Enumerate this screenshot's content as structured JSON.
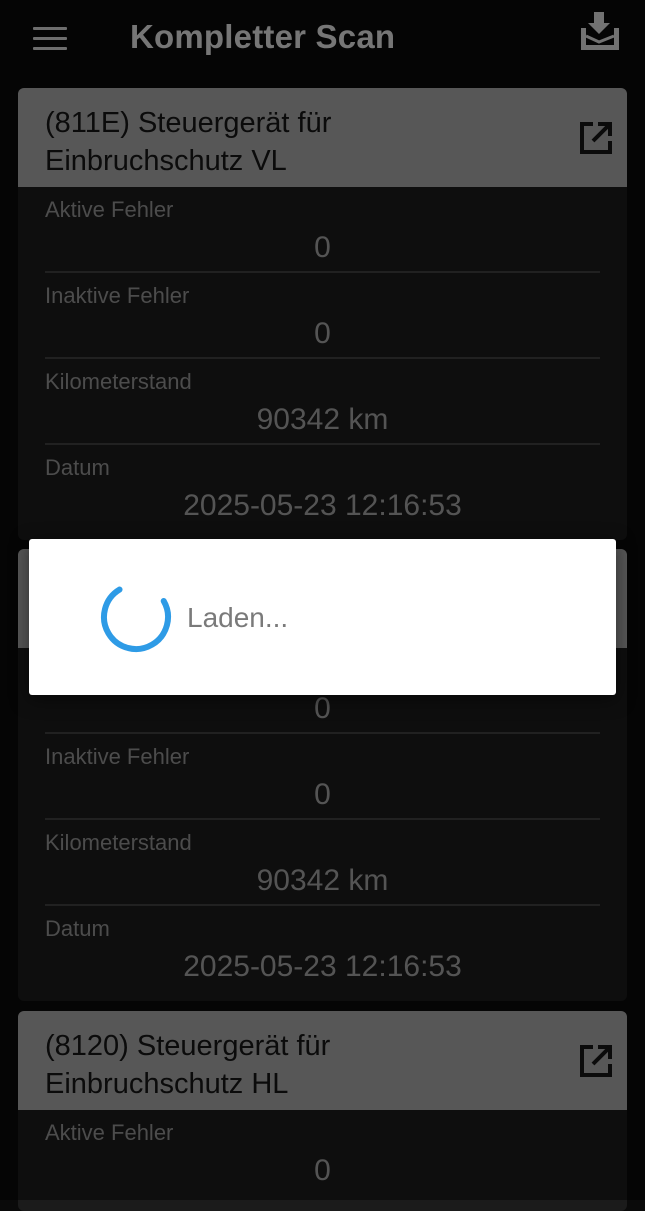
{
  "app_bar": {
    "title": "Kompletter Scan",
    "menu_icon": "hamburger-menu-icon",
    "download_icon": "download-tray-icon"
  },
  "cards": [
    {
      "title_line1": "(811E) Steuergerät für",
      "title_line2": "Einbruchschutz VL",
      "open_icon": "open-external-icon",
      "fields": [
        {
          "label": "Aktive Fehler",
          "value": "0"
        },
        {
          "label": "Inaktive Fehler",
          "value": "0"
        },
        {
          "label": "Kilometerstand",
          "value": "90342 km"
        },
        {
          "label": "Datum",
          "value": "2025-05-23 12:16:53"
        }
      ]
    },
    {
      "title_line1": "",
      "title_line2": "",
      "fields": [
        {
          "label": "",
          "value": "0"
        },
        {
          "label": "Inaktive Fehler",
          "value": "0"
        },
        {
          "label": "Kilometerstand",
          "value": "90342 km"
        },
        {
          "label": "Datum",
          "value": "2025-05-23 12:16:53"
        }
      ]
    },
    {
      "title_line1": "(8120) Steuergerät für",
      "title_line2": "Einbruchschutz HL",
      "open_icon": "open-external-icon",
      "fields": [
        {
          "label": "Aktive Fehler",
          "value": "0"
        }
      ]
    }
  ],
  "dialog": {
    "text": "Laden...",
    "spinner_color": "#2e9be6"
  },
  "colors": {
    "background": "#0a0a0a",
    "card_header": "#9e9e9e",
    "card_body": "#1b1b1b",
    "accent": "#2e9be6"
  }
}
